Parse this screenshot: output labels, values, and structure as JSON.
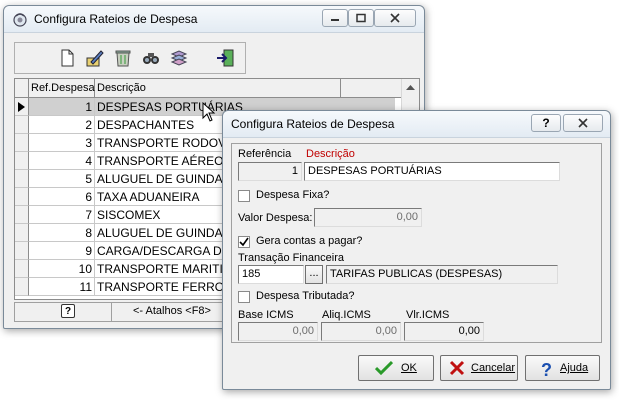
{
  "main_window": {
    "title": "Configura Rateios de Despesa",
    "grid": {
      "headers": [
        "Ref.Despesa",
        "Descrição"
      ],
      "rows": [
        {
          "ref": "1",
          "desc": "DESPESAS PORTUÁRIAS"
        },
        {
          "ref": "2",
          "desc": "DESPACHANTES"
        },
        {
          "ref": "3",
          "desc": "TRANSPORTE RODOVIÁ"
        },
        {
          "ref": "4",
          "desc": "TRANSPORTE AÉREO"
        },
        {
          "ref": "5",
          "desc": "ALUGUEL DE GUINDAST"
        },
        {
          "ref": "6",
          "desc": "TAXA ADUANEIRA"
        },
        {
          "ref": "7",
          "desc": "SISCOMEX"
        },
        {
          "ref": "8",
          "desc": "ALUGUEL DE GUINDAST"
        },
        {
          "ref": "9",
          "desc": "CARGA/DESCARGA DE M"
        },
        {
          "ref": "10",
          "desc": "TRANSPORTE MARITIMO"
        },
        {
          "ref": "11",
          "desc": "TRANSPORTE FERROVIÁ"
        }
      ]
    },
    "status": {
      "help_glyph": "?",
      "shortcut": "<- Atalhos <F8>"
    }
  },
  "dialog": {
    "title": "Configura Rateios de Despesa",
    "help_glyph": "?",
    "referencia_label": "Referência",
    "descricao_label": "Descrição",
    "referencia_value": "1",
    "descricao_value": "DESPESAS PORTUÁRIAS",
    "despesa_fixa_label": "Despesa Fixa?",
    "despesa_fixa_checked": false,
    "valor_despesa_label": "Valor Despesa:",
    "valor_despesa_value": "0,00",
    "gera_contas_label": "Gera contas a pagar?",
    "gera_contas_checked": true,
    "transacao_label": "Transação Financeira",
    "transacao_code": "185",
    "transacao_browse": "...",
    "transacao_desc": "TARIFAS PUBLICAS (DESPESAS)",
    "despesa_tributada_label": "Despesa Tributada?",
    "despesa_tributada_checked": false,
    "base_icms_label": "Base ICMS",
    "aliq_icms_label": "Aliq.ICMS",
    "vlr_icms_label": "Vlr.ICMS",
    "base_icms_value": "0,00",
    "aliq_icms_value": "0,00",
    "vlr_icms_value": "0,00",
    "ok_label": "OK",
    "cancel_label": "Cancelar",
    "help_label": "Ajuda"
  },
  "colors": {
    "descricao_label": "#c00000",
    "ok_check": "#2a9a2a",
    "cancel_x": "#c01010",
    "help_q": "#1a4fb0"
  }
}
